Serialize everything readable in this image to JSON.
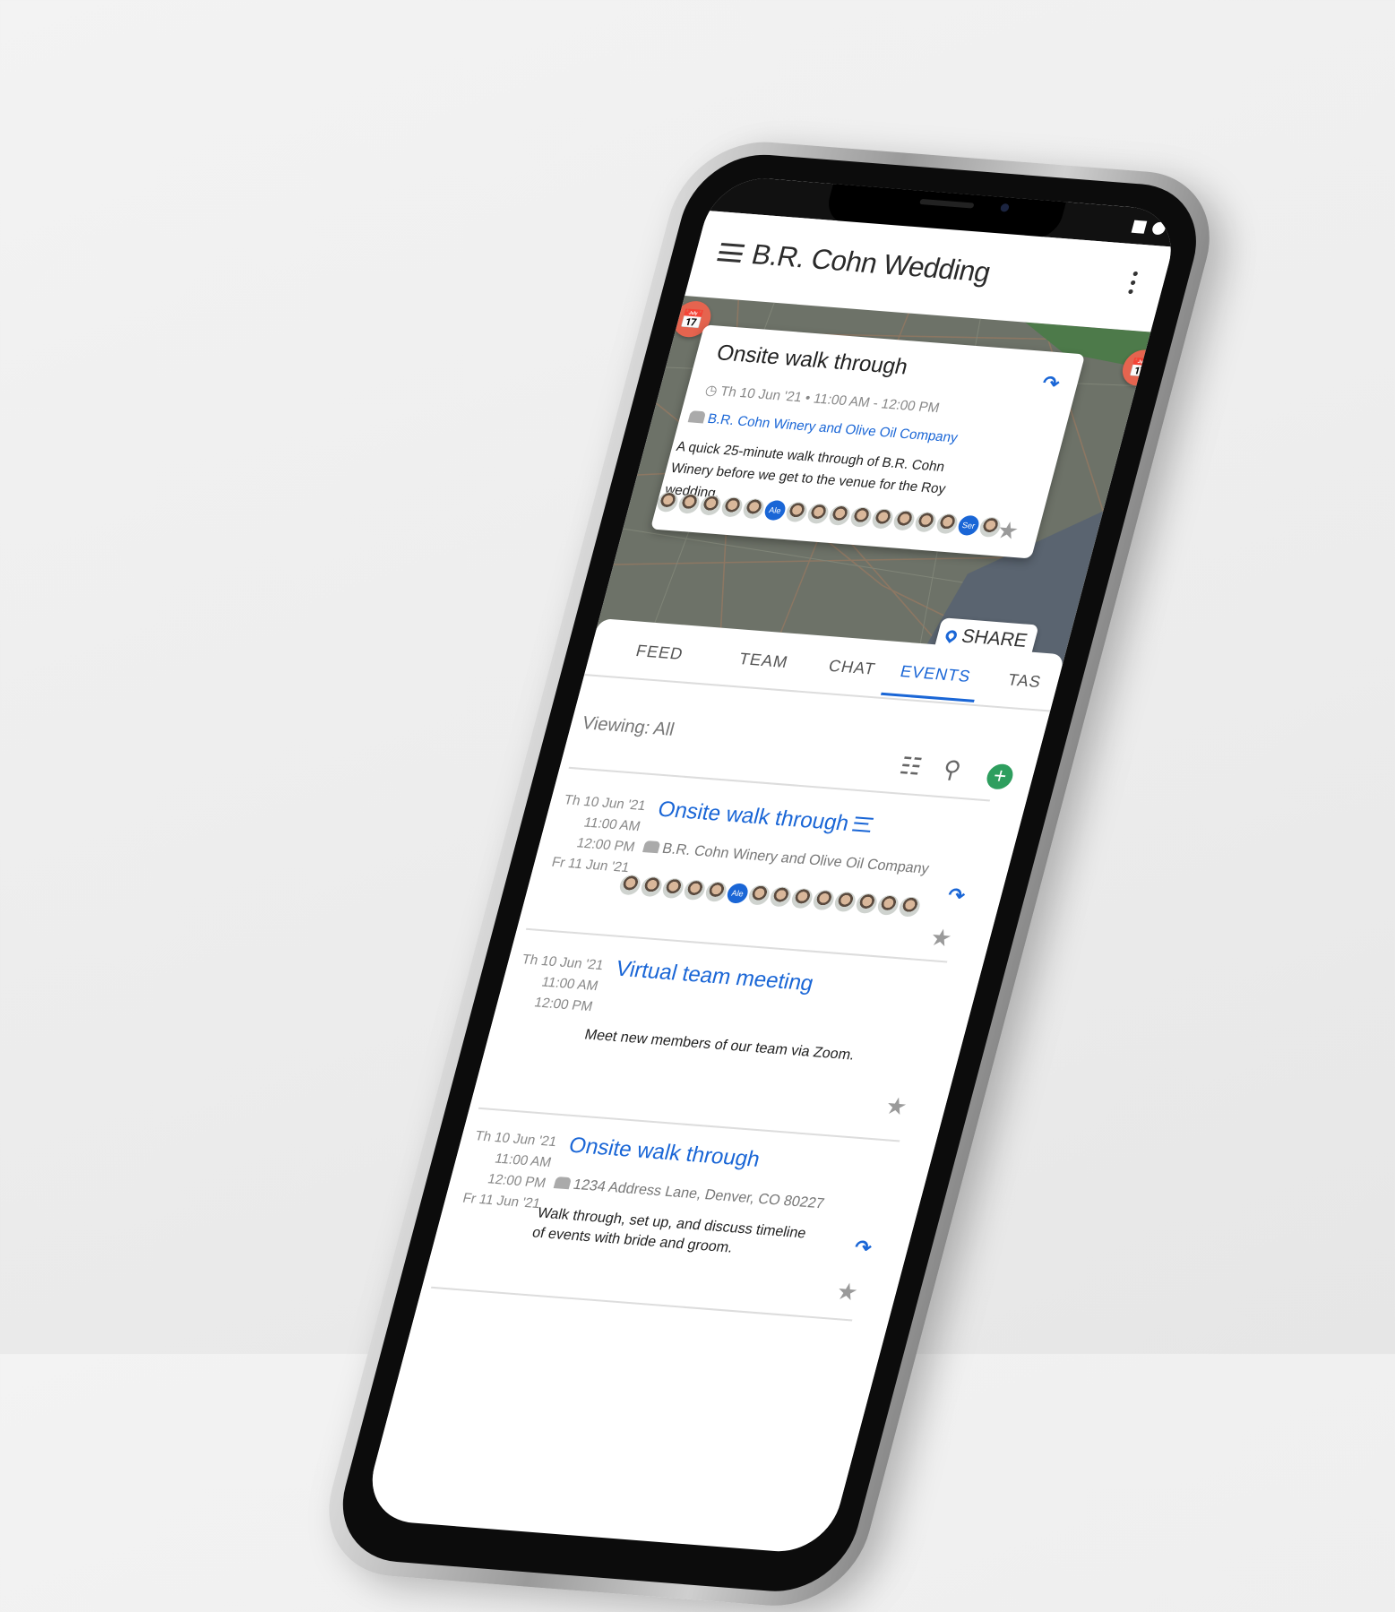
{
  "app": {
    "title": "B.R. Cohn Wedding",
    "menu_icon": "hamburger-icon",
    "more_icon": "kebab-icon"
  },
  "map_card": {
    "title": "Onsite walk through",
    "datetime": "Th 10 Jun '21 • 11:00 AM - 12:00 PM",
    "location": "B.R. Cohn Winery and Olive Oil Company",
    "description": "A quick 25-minute walk through of B.R. Cohn Winery before we get to the venue for the Roy wedding.",
    "avatars": [
      "",
      "",
      "",
      "",
      "",
      "Ale",
      "",
      "",
      "",
      "",
      "",
      "",
      "",
      "",
      "Ser",
      ""
    ]
  },
  "share_button": "SHARE",
  "tabs": [
    {
      "label": "FEED"
    },
    {
      "label": "TEAM"
    },
    {
      "label": "CHAT"
    },
    {
      "label": "EVENTS",
      "active": true
    },
    {
      "label": "TAS"
    }
  ],
  "viewing": "Viewing: All",
  "events": [
    {
      "date_start": "Th 10 Jun '21",
      "time_start": "11:00 AM",
      "time_end": "12:00 PM",
      "date_end": "Fr 11 Jun '21",
      "title": "Onsite walk through",
      "location": "B.R. Cohn Winery and Olive Oil Company",
      "avatars": [
        "",
        "",
        "",
        "",
        "",
        "Ale",
        "",
        "",
        "",
        "",
        "",
        "",
        "",
        ""
      ]
    },
    {
      "date_start": "Th 10 Jun '21",
      "time_start": "11:00 AM",
      "time_end": "12:00 PM",
      "title": "Virtual team meeting",
      "description": "Meet new members of our team via Zoom."
    },
    {
      "date_start": "Th 10 Jun '21",
      "time_start": "11:00 AM",
      "time_end": "12:00 PM",
      "date_end": "Fr 11 Jun '21",
      "title": "Onsite walk through",
      "location": "1234 Address Lane, Denver, CO 80227",
      "description": "Walk through, set up, and discuss timeline of events with bride and groom."
    }
  ],
  "colors": {
    "accent": "#1a66d6",
    "marker": "#e5644f",
    "add": "#2e9e5e",
    "map": "#6d7268"
  }
}
